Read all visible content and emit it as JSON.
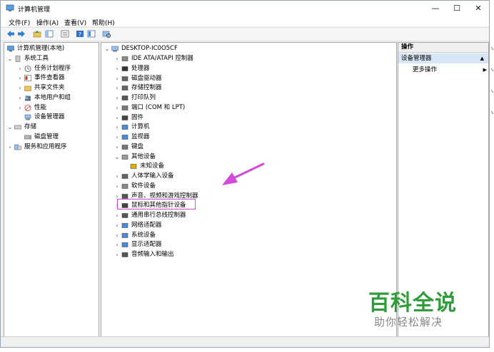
{
  "window": {
    "title": "计算机管理",
    "minimize": "—",
    "maximize": "☐",
    "close": "✕"
  },
  "menu": {
    "file": "文件(F)",
    "action": "操作(A)",
    "view": "查看(V)",
    "help": "帮助(H)"
  },
  "left_tree": {
    "root": "计算机管理(本地)",
    "system_tools": "系统工具",
    "task_scheduler": "任务计划程序",
    "event_viewer": "事件查看器",
    "shared_folders": "共享文件夹",
    "local_users": "本地用户和组",
    "performance": "性能",
    "device_manager": "设备管理器",
    "storage": "存储",
    "disk_management": "磁盘管理",
    "services_apps": "服务和应用程序"
  },
  "device_tree": {
    "computer_name": "DESKTOP-IC0O5CF",
    "items": [
      "IDE ATA/ATAPI 控制器",
      "处理器",
      "磁盘驱动器",
      "存储控制器",
      "打印队列",
      "端口 (COM 和 LPT)",
      "固件",
      "计算机",
      "监视器",
      "键盘",
      "其他设备",
      "未知设备",
      "人体学输入设备",
      "软件设备",
      "声音、视频和游戏控制器",
      "鼠标和其他指针设备",
      "通用串行总线控制器",
      "网络适配器",
      "系统设备",
      "显示适配器",
      "音频输入和输出"
    ]
  },
  "actions": {
    "header": "操作",
    "section": "设备管理器",
    "more": "更多操作",
    "section_arrow": "▲",
    "more_arrow": "▶"
  },
  "watermark": {
    "main": "百科全说",
    "sub": "助你轻松解决"
  },
  "colors": {
    "highlight": "#d24ad8",
    "watermark_green": "#2f9e3a",
    "selection": "#d7e6f5"
  }
}
